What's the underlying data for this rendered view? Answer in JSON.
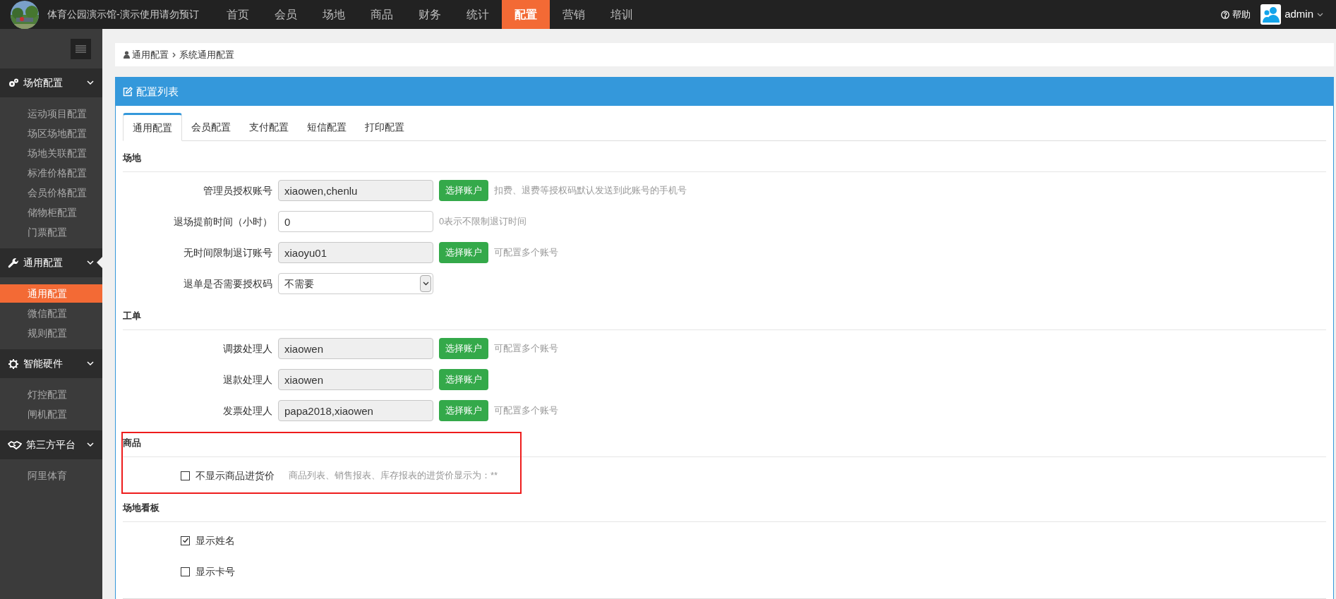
{
  "header": {
    "site_title": "体育公园演示馆-演示使用请勿预订",
    "nav": [
      {
        "label": "首页",
        "selected": false
      },
      {
        "label": "会员",
        "selected": false
      },
      {
        "label": "场地",
        "selected": false
      },
      {
        "label": "商品",
        "selected": false
      },
      {
        "label": "财务",
        "selected": false
      },
      {
        "label": "统计",
        "selected": false
      },
      {
        "label": "配置",
        "selected": true
      },
      {
        "label": "营销",
        "selected": false
      },
      {
        "label": "培训",
        "selected": false
      }
    ],
    "help": "帮助",
    "user": "admin"
  },
  "sidebar": {
    "groups": [
      {
        "title": "场馆配置",
        "kind": "cogs",
        "expanded": true,
        "items": [
          {
            "label": "运动项目配置",
            "selected": false
          },
          {
            "label": "场区场地配置",
            "selected": false
          },
          {
            "label": "场地关联配置",
            "selected": false
          },
          {
            "label": "标准价格配置",
            "selected": false
          },
          {
            "label": "会员价格配置",
            "selected": false
          },
          {
            "label": "储物柜配置",
            "selected": false
          },
          {
            "label": "门票配置",
            "selected": false
          }
        ]
      },
      {
        "title": "通用配置",
        "kind": "wrench",
        "expanded": true,
        "items": [
          {
            "label": "通用配置",
            "selected": true
          },
          {
            "label": "微信配置",
            "selected": false
          },
          {
            "label": "规则配置",
            "selected": false
          }
        ]
      },
      {
        "title": "智能硬件",
        "kind": "gear",
        "expanded": true,
        "items": [
          {
            "label": "灯控配置",
            "selected": false
          },
          {
            "label": "闸机配置",
            "selected": false
          }
        ]
      },
      {
        "title": "第三方平台",
        "kind": "handshake",
        "expanded": true,
        "items": [
          {
            "label": "阿里体育",
            "selected": false
          }
        ]
      }
    ]
  },
  "breadcrumb": [
    "通用配置",
    "系统通用配置"
  ],
  "panel": {
    "title": "配置列表",
    "tabs": [
      {
        "label": "通用配置",
        "selected": true
      },
      {
        "label": "会员配置",
        "selected": false
      },
      {
        "label": "支付配置",
        "selected": false
      },
      {
        "label": "短信配置",
        "selected": false
      },
      {
        "label": "打印配置",
        "selected": false
      }
    ],
    "sections": [
      {
        "title": "场地",
        "highlighted": false,
        "fields": [
          {
            "kind": "input",
            "label": "管理员授权账号",
            "value": "xiaowen,chenlu",
            "readonly": true,
            "button": "选择账户",
            "hint": "扣费、退费等授权码默认发送到此账号的手机号"
          },
          {
            "kind": "input",
            "label": "退场提前时间（小时）",
            "value": "0",
            "readonly": false,
            "hint": "0表示不限制退订时间"
          },
          {
            "kind": "input",
            "label": "无时间限制退订账号",
            "value": "xiaoyu01",
            "readonly": true,
            "button": "选择账户",
            "hint": "可配置多个账号"
          },
          {
            "kind": "select",
            "label": "退单是否需要授权码",
            "value": "不需要"
          }
        ]
      },
      {
        "title": "工单",
        "highlighted": false,
        "fields": [
          {
            "kind": "input",
            "label": "调拨处理人",
            "value": "xiaowen",
            "readonly": true,
            "button": "选择账户",
            "hint": "可配置多个账号"
          },
          {
            "kind": "input",
            "label": "退款处理人",
            "value": "xiaowen",
            "readonly": true,
            "button": "选择账户"
          },
          {
            "kind": "input",
            "label": "发票处理人",
            "value": "papa2018,xiaowen",
            "readonly": true,
            "button": "选择账户",
            "hint": "可配置多个账号"
          }
        ]
      },
      {
        "title": "商品",
        "highlighted": true,
        "fields": [
          {
            "kind": "checkbox",
            "label": "不显示商品进货价",
            "checked": false,
            "hint": "商品列表、销售报表、库存报表的进货价显示为：**"
          }
        ]
      },
      {
        "title": "场地看板",
        "highlighted": false,
        "fields": [
          {
            "kind": "checkbox",
            "label": "显示姓名",
            "checked": true
          },
          {
            "kind": "checkbox",
            "label": "显示卡号",
            "checked": false
          }
        ]
      }
    ]
  }
}
